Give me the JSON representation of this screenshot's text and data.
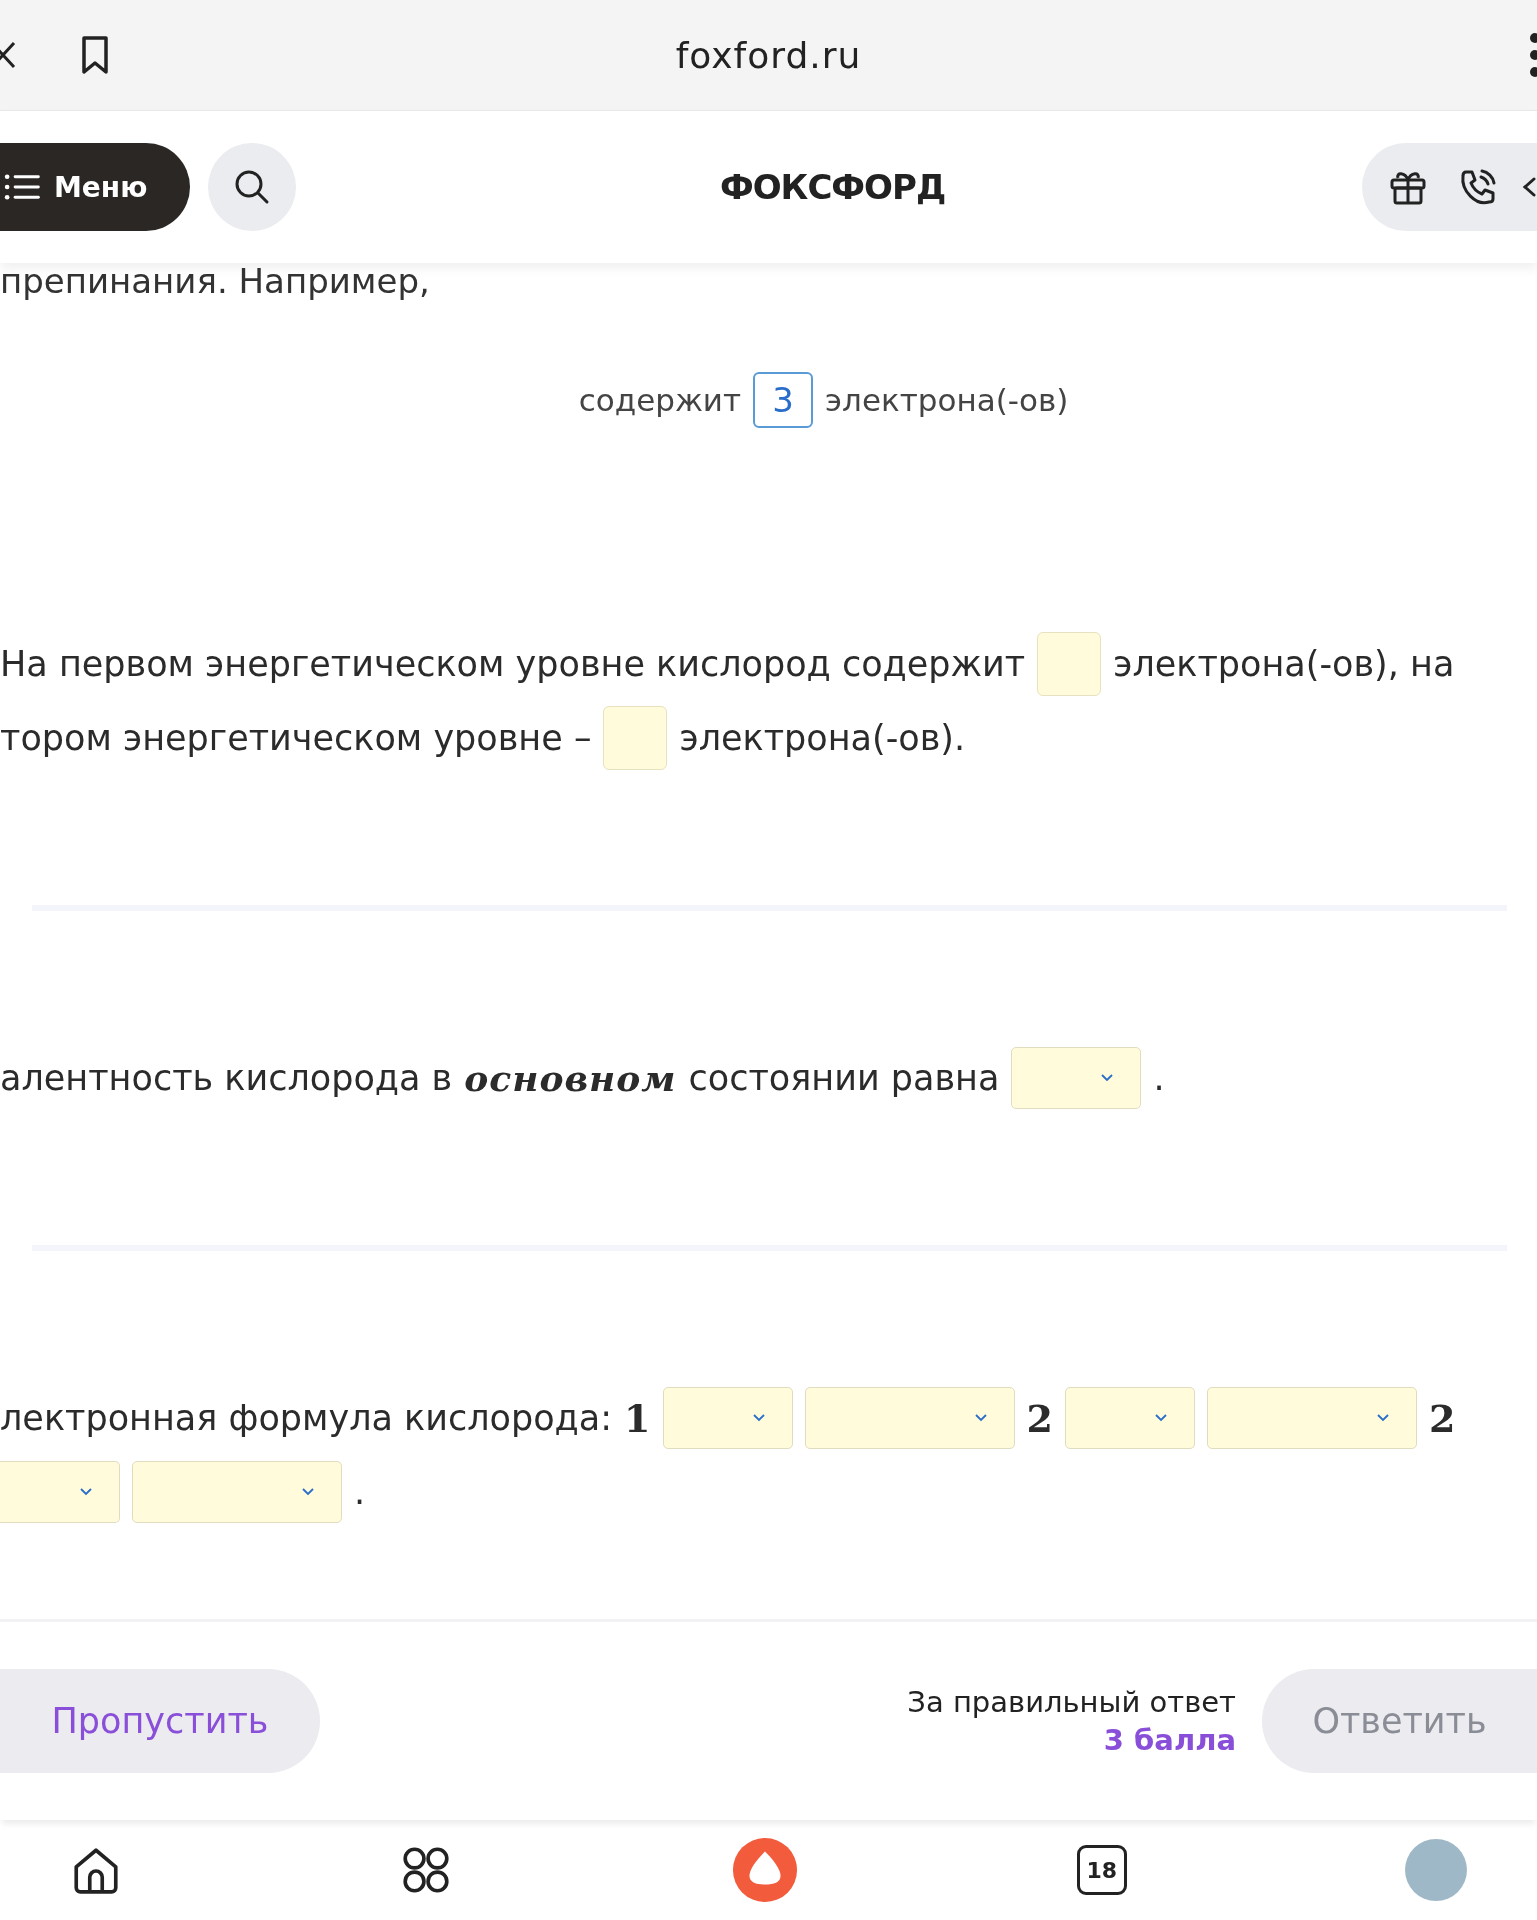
{
  "browser_bar": {
    "url": "foxford.ru"
  },
  "header": {
    "menu_label": "Меню",
    "logo": "ФОКСФОРД"
  },
  "intro_text": "препинания. Например,",
  "example": [
    {
      "kind": "text",
      "text": "содержит"
    },
    {
      "kind": "input",
      "value": "3",
      "filled": true
    },
    {
      "kind": "text",
      "text": "электрона(-ов)"
    }
  ],
  "questions": [
    {
      "lines": [
        [
          {
            "kind": "text",
            "text": "На первом энергетическом уровне кислород содержит"
          },
          {
            "kind": "input",
            "filled": false
          },
          {
            "kind": "text",
            "text": "электрона(-ов), на"
          }
        ],
        [
          {
            "kind": "text",
            "text": "тором энергетическом уровне –"
          },
          {
            "kind": "input",
            "filled": false
          },
          {
            "kind": "text",
            "text": "электрона(-ов)."
          }
        ]
      ]
    },
    {
      "lines": [
        [
          {
            "kind": "text",
            "text": "алентность кислорода в"
          },
          {
            "kind": "math",
            "text": "основном"
          },
          {
            "kind": "text",
            "text": "состоянии равна"
          },
          {
            "kind": "select",
            "wide": false
          },
          {
            "kind": "text",
            "text": "."
          }
        ]
      ]
    },
    {
      "lines": [
        [
          {
            "kind": "text",
            "text": "лектронная формула кислорода:"
          },
          {
            "kind": "number",
            "text": "1"
          },
          {
            "kind": "select",
            "wide": false
          },
          {
            "kind": "select",
            "wide": true
          },
          {
            "kind": "number",
            "text": "2"
          },
          {
            "kind": "select",
            "wide": false
          },
          {
            "kind": "select",
            "wide": true
          },
          {
            "kind": "number",
            "text": "2"
          }
        ],
        [
          {
            "kind": "select",
            "wide": false,
            "cut": true
          },
          {
            "kind": "select",
            "wide": true
          },
          {
            "kind": "text",
            "text": "."
          }
        ]
      ]
    }
  ],
  "footer": {
    "skip_label": "Пропустить",
    "reward_label": "За правильный ответ",
    "reward_points": "3 балла",
    "answer_label": "Ответить",
    "answer_disabled": true
  },
  "bottom_nav": {
    "calendar_day": "18"
  }
}
